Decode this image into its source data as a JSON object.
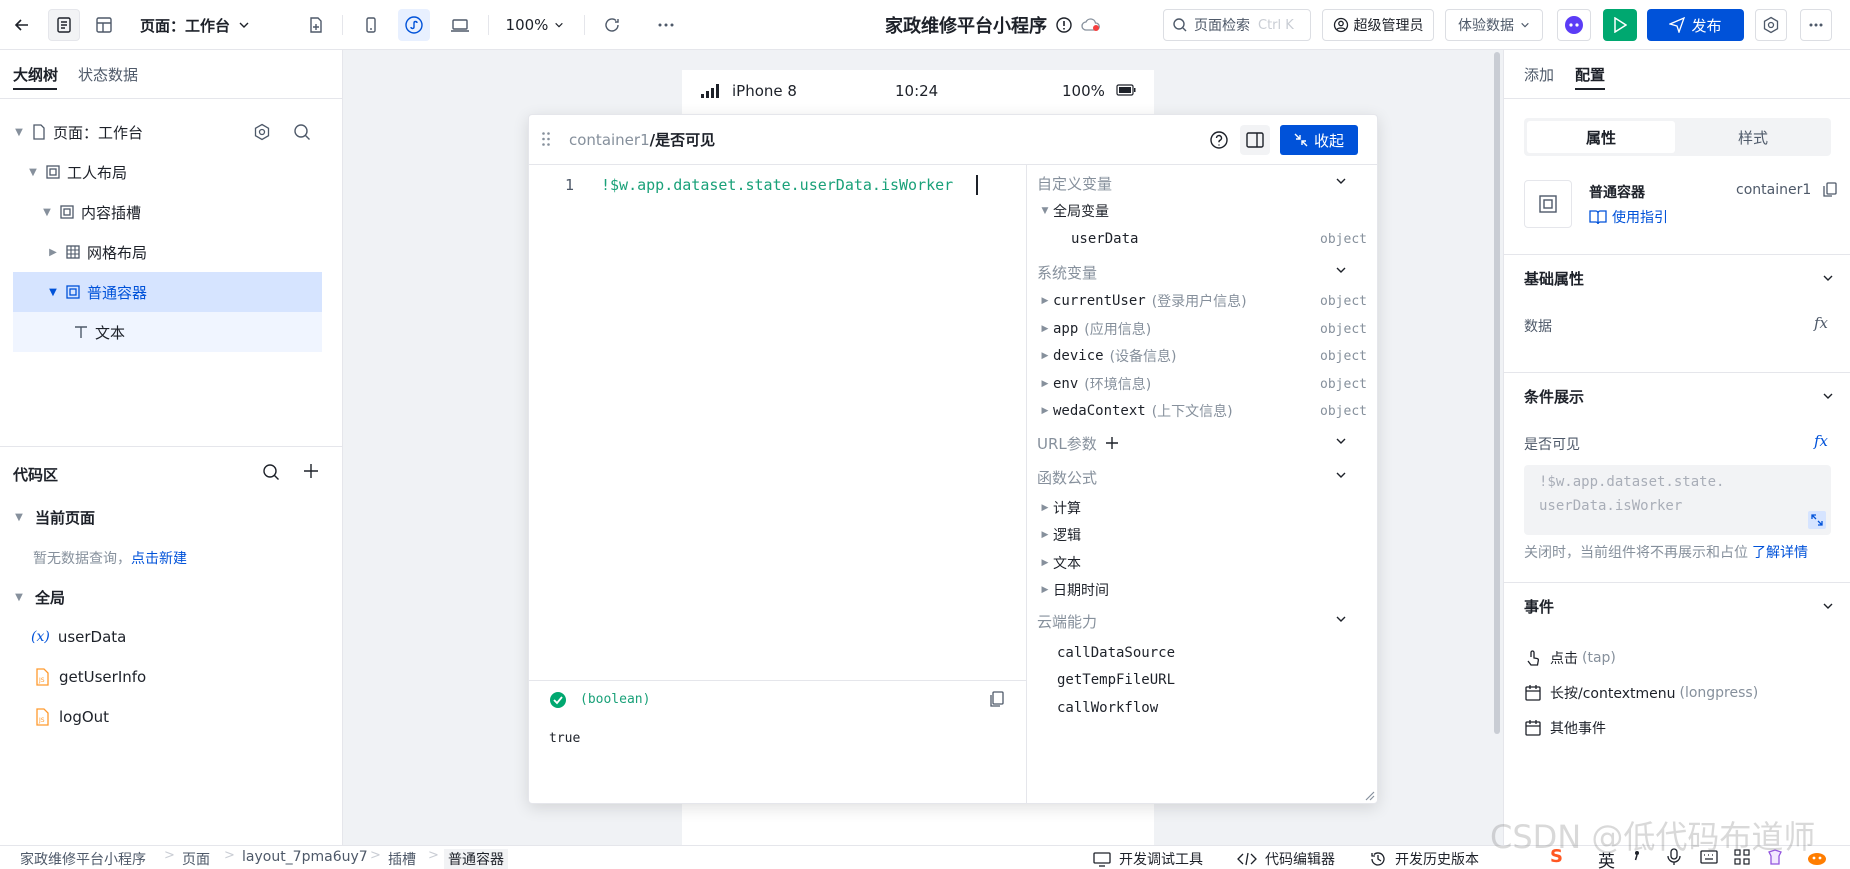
{
  "topbar": {
    "page_label": "页面：工作台",
    "zoom": "100%",
    "app_title": "家政维修平台小程序",
    "search_placeholder": "页面检索",
    "search_shortcut": "Ctrl K",
    "admin_label": "超级管理员",
    "data_select": "体验数据",
    "publish_label": "发布"
  },
  "left": {
    "tabs": [
      "大纲树",
      "状态数据"
    ],
    "tree": [
      {
        "label": "页面：工作台"
      },
      {
        "label": "工人布局"
      },
      {
        "label": "内容插槽"
      },
      {
        "label": "网格布局"
      },
      {
        "label": "普通容器"
      },
      {
        "label": "文本"
      }
    ],
    "code_title": "代码区",
    "current_page": "当前页面",
    "empty_text": "暂无数据查询，",
    "empty_link": "点击新建",
    "global_title": "全局",
    "globals": [
      "userData",
      "getUserInfo",
      "logOut"
    ]
  },
  "phone": {
    "device": "iPhone 8",
    "time": "10:24",
    "battery": "100%"
  },
  "editor": {
    "crumb_prefix": "container1",
    "crumb_title": "/是否可见",
    "collapse_label": "收起",
    "line_no": "1",
    "code": "!$w.app.dataset.state.userData.isWorker",
    "result_type": "(boolean)",
    "result_value": "true",
    "sections": {
      "custom": "自定义变量",
      "global": "全局变量",
      "system": "系统变量",
      "url": "URL参数",
      "funcs": "函数公式",
      "cloud": "云端能力"
    },
    "custom_vars": [
      {
        "name": "userData",
        "type": "object"
      }
    ],
    "system_vars": [
      {
        "name": "currentUser",
        "desc": "(登录用户信息)",
        "type": "object"
      },
      {
        "name": "app",
        "desc": "(应用信息)",
        "type": "object"
      },
      {
        "name": "device",
        "desc": "(设备信息)",
        "type": "object"
      },
      {
        "name": "env",
        "desc": "(环境信息)",
        "type": "object"
      },
      {
        "name": "wedaContext",
        "desc": "(上下文信息)",
        "type": "object"
      }
    ],
    "funcs": [
      "计算",
      "逻辑",
      "文本",
      "日期时间"
    ],
    "cloud": [
      "callDataSource",
      "getTempFileURL",
      "callWorkflow"
    ]
  },
  "right": {
    "tabs": [
      "添加",
      "配置"
    ],
    "seg": [
      "属性",
      "样式"
    ],
    "comp_name": "普通容器",
    "comp_id": "container1",
    "guide": "使用指引",
    "basic_title": "基础属性",
    "data_label": "数据",
    "cond_title": "条件展示",
    "visible_label": "是否可见",
    "visible_line1": "!$w.app.dataset.state.",
    "visible_line2": "userData.isWorker",
    "hint": "关闭时，当前组件将不再展示和占位",
    "hint_link": "了解详情",
    "events_title": "事件",
    "events": [
      {
        "label": "点击",
        "code": "(tap)"
      },
      {
        "label": "长按/contextmenu",
        "code": "(longpress)"
      },
      {
        "label": "其他事件",
        "code": ""
      }
    ],
    "fx_label": "fx"
  },
  "bottom": {
    "breadcrumb": [
      "家政维修平台小程序",
      "页面",
      "layout_7pma6uy7",
      "插槽",
      "普通容器"
    ],
    "tools": [
      "开发调试工具",
      "代码编辑器",
      "开发历史版本"
    ],
    "watermark": "CSDN @低代码布道师",
    "ime": "英"
  },
  "colors": {
    "primary": "#0052d9",
    "green": "#00a870",
    "code": "#1aa179"
  }
}
